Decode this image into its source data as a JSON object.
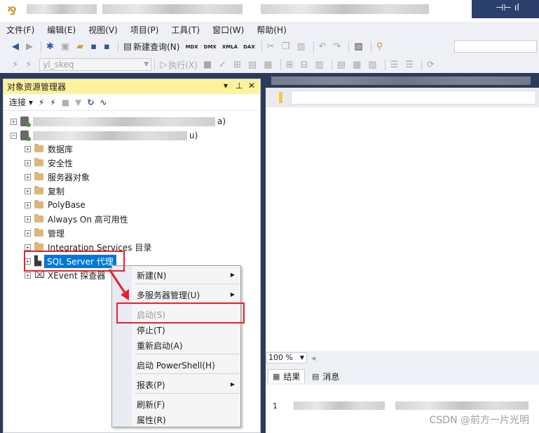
{
  "menubar": {
    "items": [
      "文件(F)",
      "编辑(E)",
      "视图(V)",
      "项目(P)",
      "工具(T)",
      "窗口(W)",
      "帮助(H)"
    ]
  },
  "toolbar": {
    "new_query_label": "新建查询(N)",
    "mdx_label": "MDX",
    "dmx_label": "DMX",
    "xmla_label": "XMLA",
    "dax_label": "DAX",
    "database_value": "yl_skeq",
    "execute_label": "执行(X)"
  },
  "object_explorer": {
    "title": "对象资源管理器",
    "connect_label": "连接",
    "server1_suffix": "a)",
    "server2_suffix": "u)",
    "nodes": [
      {
        "label": "数据库"
      },
      {
        "label": "安全性"
      },
      {
        "label": "服务器对象"
      },
      {
        "label": "复制"
      },
      {
        "label": "PolyBase"
      },
      {
        "label": "Always On 高可用性"
      },
      {
        "label": "管理"
      },
      {
        "label": "Integration Services 目录"
      }
    ],
    "agent_label": "SQL Server 代理",
    "xevent_label": "XEvent 探查器"
  },
  "context_menu": {
    "new": "新建(N)",
    "multi_server": "多服务器管理(U)",
    "start": "启动(S)",
    "stop": "停止(T)",
    "restart": "重新启动(A)",
    "powershell": "启动 PowerShell(H)",
    "reports": "报表(P)",
    "refresh": "刷新(F)",
    "properties": "属性(R)"
  },
  "document": {
    "zoom": "100 %",
    "results_tab": "结果",
    "messages_tab": "消息",
    "row_number": "1"
  },
  "watermark": "CSDN @前方一片光明",
  "colors": {
    "selection": "#0078d7",
    "highlight_box": "#e8212b",
    "panel_title": "#fff29d",
    "dark_chrome": "#2b3b5a"
  }
}
